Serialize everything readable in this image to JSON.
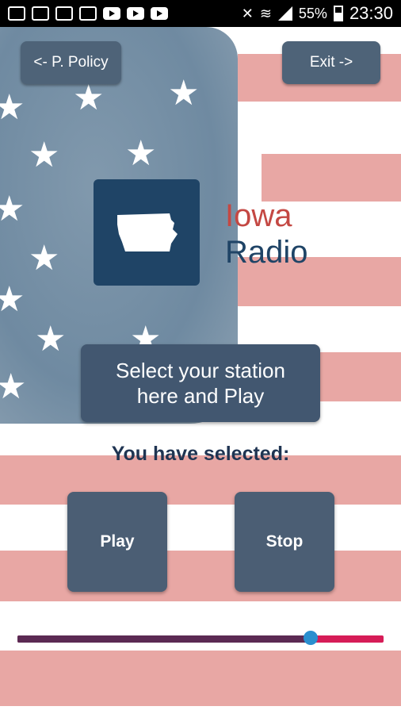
{
  "status_bar": {
    "battery": "55%",
    "time": "23:30"
  },
  "header": {
    "policy_button": "<- P. Policy",
    "exit_button": "Exit ->"
  },
  "logo": {
    "word1": "Iowa",
    "word2": "Radio"
  },
  "station_selector": {
    "line1": "Select your station",
    "line2": "here and Play"
  },
  "selection": {
    "label": "You have selected:"
  },
  "controls": {
    "play": "Play",
    "stop": "Stop"
  },
  "volume": {
    "level": 0.8
  },
  "colors": {
    "accent_red": "#c44843",
    "navy": "#1f4466",
    "slider_fill": "#5b2a53",
    "slider_track": "#d61c57",
    "slider_thumb": "#2a8fcf"
  }
}
